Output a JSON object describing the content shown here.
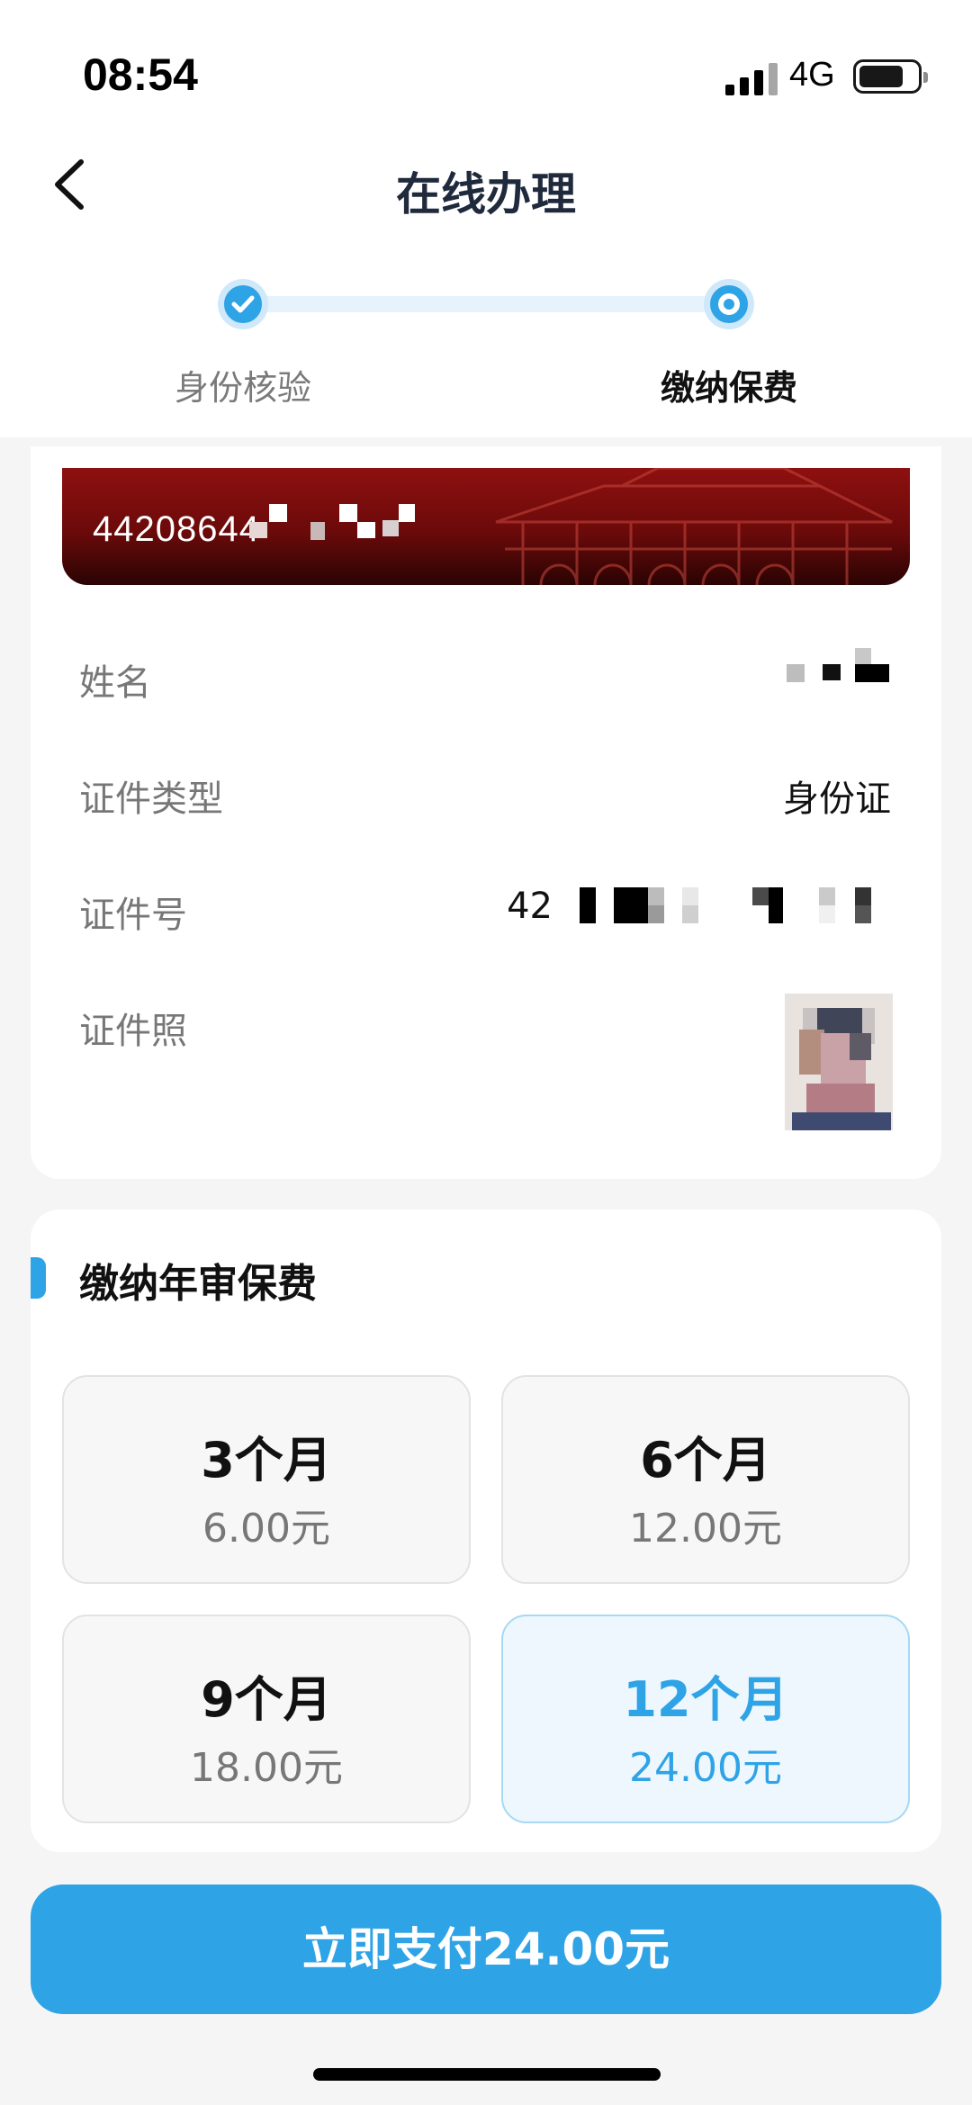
{
  "status_bar": {
    "time": "08:54",
    "network": "4G",
    "battery_level": 0.7
  },
  "nav": {
    "title": "在线办理",
    "back_icon": "chevron-left-icon"
  },
  "steps": [
    {
      "label": "身份核验",
      "state": "done"
    },
    {
      "label": "缴纳保费",
      "state": "current"
    }
  ],
  "id_card": {
    "number_visible": "44208644"
  },
  "info": {
    "rows": [
      {
        "label": "姓名",
        "value": ""
      },
      {
        "label": "证件类型",
        "value": "身份证"
      },
      {
        "label": "证件号",
        "value": "42"
      },
      {
        "label": "证件照",
        "value": ""
      }
    ]
  },
  "fee": {
    "title": "缴纳年审保费",
    "options": [
      {
        "duration": "3个月",
        "price": "6.00元",
        "selected": false
      },
      {
        "duration": "6个月",
        "price": "12.00元",
        "selected": false
      },
      {
        "duration": "9个月",
        "price": "18.00元",
        "selected": false
      },
      {
        "duration": "12个月",
        "price": "24.00元",
        "selected": true
      }
    ]
  },
  "pay_button": {
    "label": "立即支付24.00元"
  },
  "colors": {
    "accent": "#2ea3e6",
    "accent_light": "#edf7fd",
    "card_red": "#8e1010"
  }
}
